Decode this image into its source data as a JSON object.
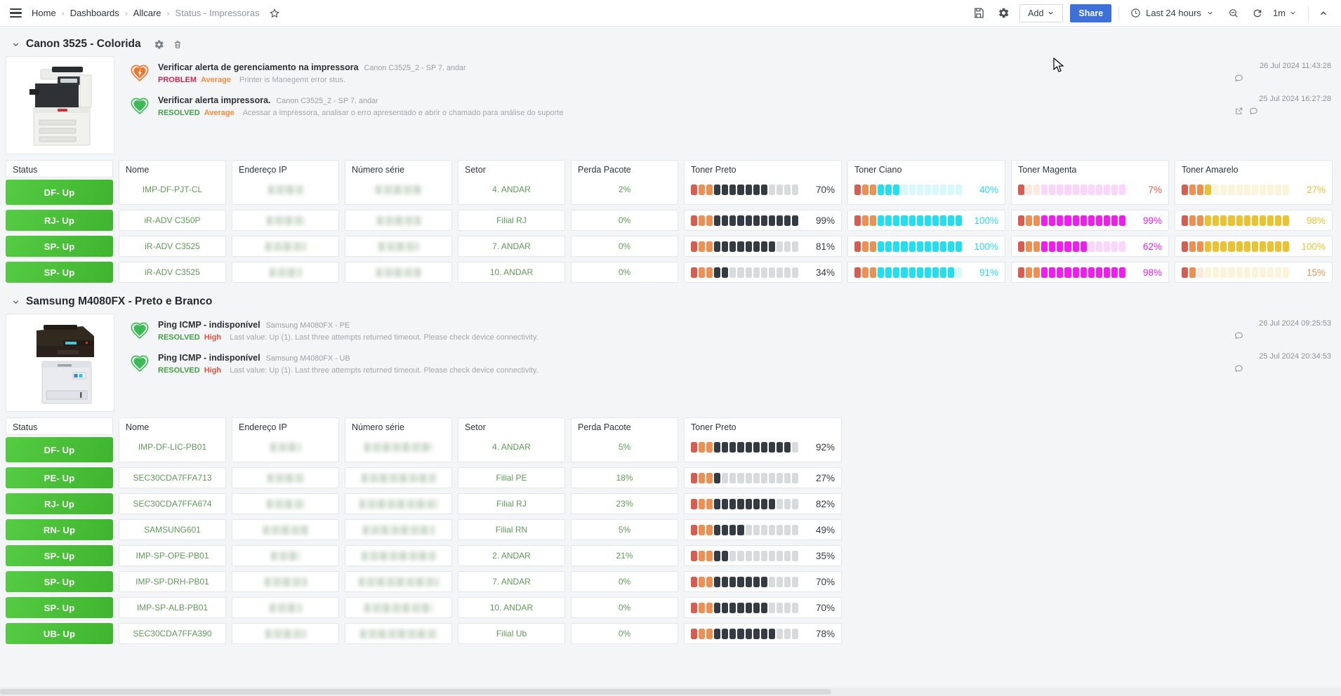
{
  "nav": {
    "breadcrumbs": [
      {
        "label": "Home"
      },
      {
        "label": "Dashboards"
      },
      {
        "label": "Allcare"
      },
      {
        "label": "Status - Impressoras"
      }
    ],
    "add_label": "Add",
    "share_label": "Share",
    "time_range": "Last 24 hours",
    "refresh_interval": "1m"
  },
  "palette": {
    "problem": "#cb2a52",
    "resolved": "#43a047",
    "average": "#f98b3a",
    "high": "#e4513f",
    "up_green": "#4cc73d",
    "link_blue": "#3d71d9",
    "value_green": "#5d9b55"
  },
  "gauge": {
    "cells": 14,
    "colors": {
      "red": "#d95c50",
      "orange": "#ee9051",
      "preto": "#343b43",
      "ciano": "#1fdff0",
      "magenta": "#f21cf2",
      "amarelo": "#ecc230"
    }
  },
  "sections": [
    {
      "title": "Canon 3525 - Colorida",
      "has_actions": true,
      "alerts": [
        {
          "kind": "problem",
          "title": "Verificar alerta de gerenciamento na impressora",
          "host": "Canon C3525_2 - SP 7. andar",
          "status": "PROBLEM",
          "status_key": "problem",
          "severity": "Average",
          "severity_key": "average",
          "message": "Printer is Manegemt error stus.",
          "timestamp": "26 Jul 2024 11:43:28",
          "has_link_icon": false
        },
        {
          "kind": "resolved",
          "title": "Verificar alerta impressora.",
          "host": "Canon C3525_2 - SP 7. andar",
          "status": "RESOLVED",
          "status_key": "resolved",
          "severity": "Average",
          "severity_key": "average",
          "message": "Acessar a impressora, analisar o erro apresentado e abrir o chamado para análise do suporte",
          "timestamp": "25 Jul 2024 16:27:28",
          "has_link_icon": true
        }
      ],
      "columns": [
        {
          "label": "Status",
          "type": "status"
        },
        {
          "label": "Nome",
          "type": "text",
          "key": "nome"
        },
        {
          "label": "Endereço IP",
          "type": "blur",
          "key": "ip"
        },
        {
          "label": "Número série",
          "type": "blur",
          "key": "serial"
        },
        {
          "label": "Setor",
          "type": "text",
          "key": "setor"
        },
        {
          "label": "Perda Pacote",
          "type": "text",
          "key": "perda"
        },
        {
          "label": "Toner Preto",
          "type": "toner",
          "color": "preto",
          "idx": 0
        },
        {
          "label": "Toner Ciano",
          "type": "toner",
          "color": "ciano",
          "idx": 1
        },
        {
          "label": "Toner Magenta",
          "type": "toner",
          "color": "magenta",
          "idx": 2
        },
        {
          "label": "Toner Amarelo",
          "type": "toner",
          "color": "amarelo",
          "idx": 3
        }
      ],
      "rows": [
        {
          "status": "DF- Up",
          "nome": "IMP-DF-PJT-CL",
          "setor": "4. ANDAR",
          "perda": "2%",
          "toner": [
            70,
            40,
            7,
            27
          ]
        },
        {
          "status": "RJ- Up",
          "nome": "iR-ADV C350P",
          "setor": "Filial RJ",
          "perda": "0%",
          "toner": [
            99,
            100,
            99,
            98
          ]
        },
        {
          "status": "SP- Up",
          "nome": "iR-ADV C3525",
          "setor": "7. ANDAR",
          "perda": "0%",
          "toner": [
            81,
            100,
            62,
            100
          ]
        },
        {
          "status": "SP- Up",
          "nome": "iR-ADV C3525",
          "setor": "10. ANDAR",
          "perda": "0%",
          "toner": [
            34,
            91,
            98,
            15
          ]
        }
      ]
    },
    {
      "title": "Samsung M4080FX - Preto e Branco",
      "has_actions": false,
      "alerts": [
        {
          "kind": "resolved",
          "title": "Ping ICMP - indisponível",
          "host": "Samsung M4080FX - PE",
          "status": "RESOLVED",
          "status_key": "resolved",
          "severity": "High",
          "severity_key": "high",
          "message": "Last value: Up (1). Last three attempts returned timeout. Please check device connectivity.",
          "timestamp": "26 Jul 2024 09:25:53",
          "has_link_icon": false
        },
        {
          "kind": "resolved",
          "title": "Ping ICMP - indisponível",
          "host": "Samsung M4080FX - UB",
          "status": "RESOLVED",
          "status_key": "resolved",
          "severity": "High",
          "severity_key": "high",
          "message": "Last value: Up (1). Last three attempts returned timeout. Please check device connectivity.",
          "timestamp": "25 Jul 2024 20:34:53",
          "has_link_icon": false
        }
      ],
      "columns": [
        {
          "label": "Status",
          "type": "status"
        },
        {
          "label": "Nome",
          "type": "text",
          "key": "nome"
        },
        {
          "label": "Endereço IP",
          "type": "blur",
          "key": "ip"
        },
        {
          "label": "Número série",
          "type": "blur",
          "key": "serial"
        },
        {
          "label": "Setor",
          "type": "text",
          "key": "setor"
        },
        {
          "label": "Perda Pacote",
          "type": "text",
          "key": "perda"
        },
        {
          "label": "Toner Preto",
          "type": "toner",
          "color": "preto",
          "idx": 0
        }
      ],
      "rows": [
        {
          "status": "DF- Up",
          "nome": "IMP-DF-LIC-PB01",
          "setor": "4. ANDAR",
          "perda": "5%",
          "toner": [
            92
          ]
        },
        {
          "status": "PE- Up",
          "nome": "SEC30CDA7FFA713",
          "setor": "Filial PE",
          "perda": "18%",
          "toner": [
            27
          ]
        },
        {
          "status": "RJ- Up",
          "nome": "SEC30CDA7FFA674",
          "setor": "Filial RJ",
          "perda": "23%",
          "toner": [
            82
          ]
        },
        {
          "status": "RN- Up",
          "nome": "SAMSUNG601",
          "setor": "Filial RN",
          "perda": "5%",
          "toner": [
            49
          ]
        },
        {
          "status": "SP- Up",
          "nome": "IMP-SP-OPE-PB01",
          "setor": "2. ANDAR",
          "perda": "21%",
          "toner": [
            35
          ]
        },
        {
          "status": "SP- Up",
          "nome": "IMP-SP-DRH-PB01",
          "setor": "7. ANDAR",
          "perda": "0%",
          "toner": [
            70
          ]
        },
        {
          "status": "SP- Up",
          "nome": "IMP-SP-ALB-PB01",
          "setor": "10. ANDAR",
          "perda": "0%",
          "toner": [
            70
          ]
        },
        {
          "status": "UB- Up",
          "nome": "SEC30CDA7FFA390",
          "setor": "Filial Ub",
          "perda": "0%",
          "toner": [
            78
          ]
        }
      ]
    }
  ]
}
